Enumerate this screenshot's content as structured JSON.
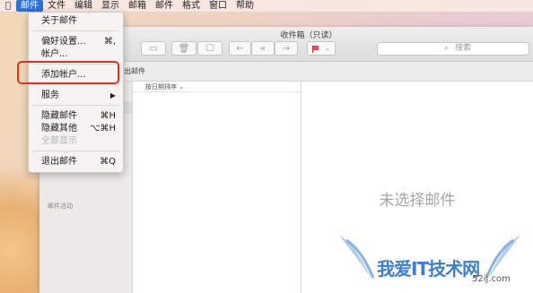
{
  "menubar": {
    "apple_icon": "apple-logo",
    "items": [
      "邮件",
      "文件",
      "编辑",
      "显示",
      "邮箱",
      "邮件",
      "格式",
      "窗口",
      "帮助"
    ],
    "active_index": 0
  },
  "window": {
    "title": "收件箱（只读）",
    "search_placeholder": "搜索",
    "favorites_bar": "已发出邮件",
    "sort_label": "按日期排序 ⌄",
    "sidebar_section": "邮件活动",
    "no_selection": "未选择邮件",
    "flag_color": "#e8465a"
  },
  "menu": {
    "items": [
      {
        "label": "关于邮件",
        "shortcut": ""
      },
      {
        "label": "偏好设置...",
        "shortcut": "⌘,"
      },
      {
        "label": "帐户...",
        "shortcut": ""
      },
      {
        "label": "添加帐户...",
        "shortcut": ""
      },
      {
        "label": "服务",
        "shortcut": "▶"
      },
      {
        "label": "隐藏邮件",
        "shortcut": "⌘H"
      },
      {
        "label": "隐藏其他",
        "shortcut": "⌥⌘H"
      },
      {
        "label": "全部显示",
        "shortcut": ""
      },
      {
        "label": "退出邮件",
        "shortcut": "⌘Q"
      }
    ],
    "highlight_color": "#e0321f"
  },
  "watermark": {
    "text": "我爱IT技术网",
    "url": "52ij.com"
  }
}
